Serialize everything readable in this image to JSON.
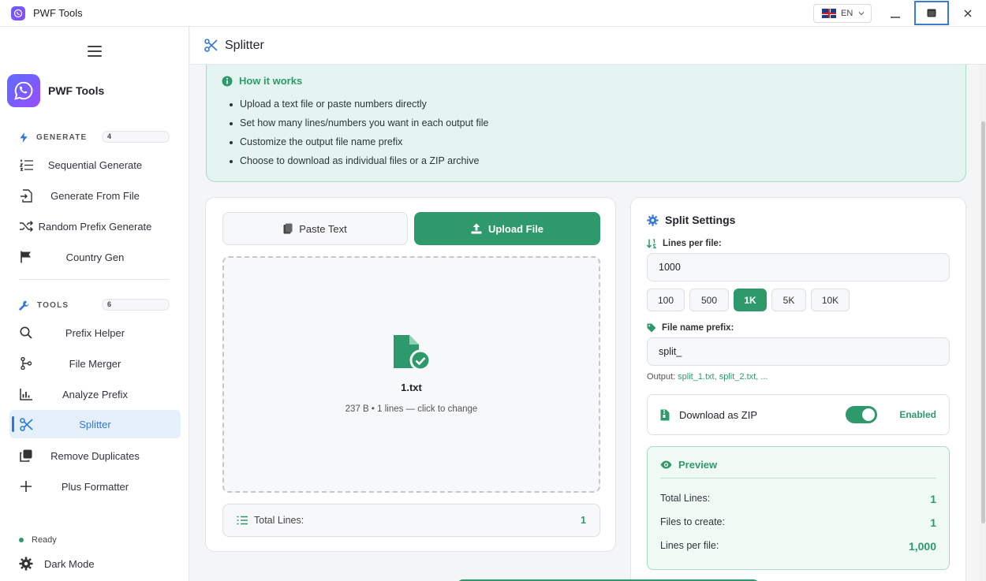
{
  "window": {
    "title": "PWF Tools",
    "language": "EN",
    "flag": "uk-flag-icon"
  },
  "sidebar": {
    "brand": "PWF Tools",
    "sections": [
      {
        "label": "GENERATE",
        "count": "4",
        "items": [
          "Sequential Generate",
          "Generate From File",
          "Random Prefix Generate",
          "Country Gen"
        ]
      },
      {
        "label": "TOOLS",
        "count": "6",
        "items": [
          "Prefix Helper",
          "File Merger",
          "Analyze Prefix",
          "Splitter",
          "Remove Duplicates",
          "Plus Formatter"
        ]
      }
    ],
    "active_item": "Splitter",
    "status": "Ready",
    "dark_mode": "Dark Mode"
  },
  "page": {
    "title": "Splitter"
  },
  "how_it_works": {
    "title": "How it works",
    "steps": [
      "Upload a text file or paste numbers directly",
      "Set how many lines/numbers you want in each output file",
      "Customize the output file name prefix",
      "Choose to download as individual files or a ZIP archive"
    ]
  },
  "input_panel": {
    "tab_paste": "Paste Text",
    "tab_upload": "Upload File",
    "active_tab": "Upload File",
    "file_name": "1.txt",
    "file_meta": "237 B • 1 lines — click to change",
    "total_lines_label": "Total Lines:",
    "total_lines_value": "1"
  },
  "settings": {
    "title": "Split Settings",
    "lines_per_file_label": "Lines per file:",
    "lines_per_file_value": "1000",
    "presets": [
      "100",
      "500",
      "1K",
      "5K",
      "10K"
    ],
    "active_preset": "1K",
    "prefix_label": "File name prefix:",
    "prefix_value": "split_",
    "output_label": "Output:",
    "output_value": "split_1.txt, split_2.txt, ...",
    "zip_label": "Download as ZIP",
    "zip_enabled": true,
    "zip_state": "Enabled"
  },
  "preview": {
    "title": "Preview",
    "rows": [
      {
        "label": "Total Lines:",
        "value": "1"
      },
      {
        "label": "Files to create:",
        "value": "1"
      },
      {
        "label": "Lines per file:",
        "value": "1,000"
      }
    ]
  },
  "colors": {
    "accent_green": "#2e9a6b",
    "active_blue": "#2f78d6",
    "info_bg": "#e4f5f1"
  }
}
